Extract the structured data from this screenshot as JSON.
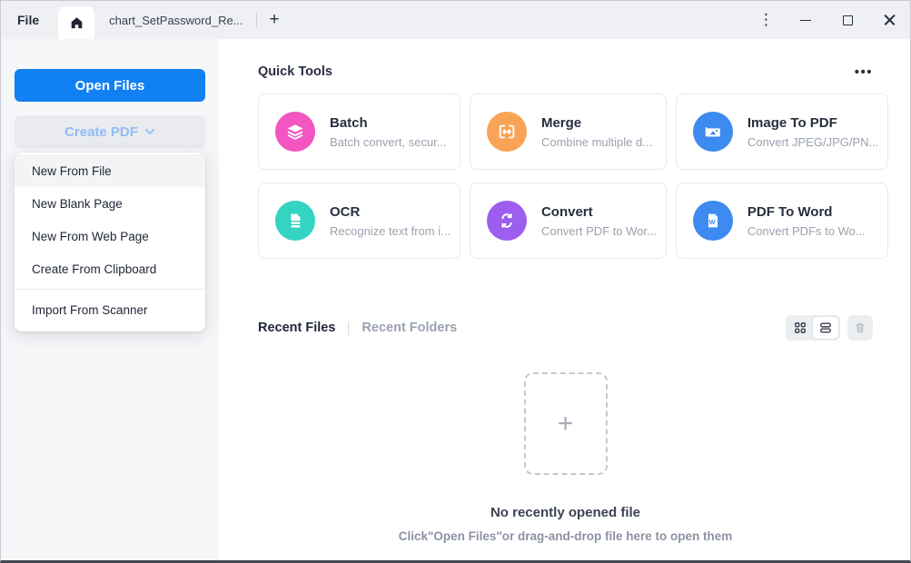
{
  "titlebar": {
    "file_menu": "File",
    "tab_title": "chart_SetPassword_Re...",
    "new_tab": "+",
    "kebab": "⋮"
  },
  "sidebar": {
    "open_files_label": "Open Files",
    "create_pdf_label": "Create PDF",
    "menu_items": [
      {
        "label": "New From File"
      },
      {
        "label": "New Blank Page"
      },
      {
        "label": "New From Web Page"
      },
      {
        "label": "Create From Clipboard"
      },
      {
        "label": "Import From Scanner"
      }
    ]
  },
  "quick_tools": {
    "title": "Quick Tools",
    "more_label": "•••",
    "cards": [
      {
        "title": "Batch",
        "subtitle": "Batch convert, secur...",
        "color": "#f356c0"
      },
      {
        "title": "Merge",
        "subtitle": "Combine multiple d...",
        "color": "#f9a357"
      },
      {
        "title": "Image To PDF",
        "subtitle": "Convert JPEG/JPG/PN...",
        "color": "#3d8af0"
      },
      {
        "title": "OCR",
        "subtitle": "Recognize text from i...",
        "color": "#35d3c2"
      },
      {
        "title": "Convert",
        "subtitle": "Convert PDF to Wor...",
        "color": "#9d5ef0"
      },
      {
        "title": "PDF To Word",
        "subtitle": "Convert PDFs to Wo...",
        "color": "#3d8af0"
      }
    ]
  },
  "recent": {
    "tabs": [
      {
        "label": "Recent Files"
      },
      {
        "label": "Recent Folders"
      }
    ],
    "dropzone_plus": "+",
    "empty_title": "No recently opened file",
    "empty_hint": "Click\"Open Files\"or drag-and-drop file here to open them"
  },
  "colors": {
    "accent_blue": "#1180f2",
    "titlebar_bg": "#eef0f4",
    "sidebar_bg": "#f5f6f8"
  }
}
